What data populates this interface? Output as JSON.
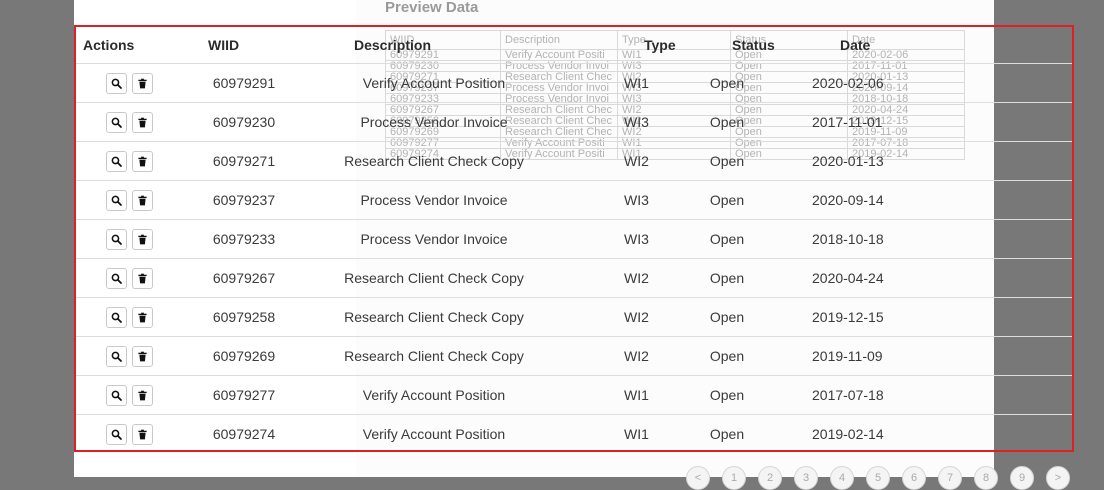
{
  "preview": {
    "title": "Preview Data",
    "columns": [
      "WIID",
      "Description",
      "Type",
      "Status",
      "Date"
    ],
    "rows": [
      [
        "60979291",
        "Verify Account Positi",
        "WI1",
        "Open",
        "2020-02-06"
      ],
      [
        "60979230",
        "Process Vendor Invoi",
        "WI3",
        "Open",
        "2017-11-01"
      ],
      [
        "60979271",
        "Research Client Chec",
        "WI2",
        "Open",
        "2020-01-13"
      ],
      [
        "60979237",
        "Process Vendor Invoi",
        "WI3",
        "Open",
        "2020-09-14"
      ],
      [
        "60979233",
        "Process Vendor Invoi",
        "WI3",
        "Open",
        "2018-10-18"
      ],
      [
        "60979267",
        "Research Client Chec",
        "WI2",
        "Open",
        "2020-04-24"
      ],
      [
        "60979258",
        "Research Client Chec",
        "WI2",
        "Open",
        "2019-12-15"
      ],
      [
        "60979269",
        "Research Client Chec",
        "WI2",
        "Open",
        "2019-11-09"
      ],
      [
        "60979277",
        "Verify Account Positi",
        "WI1",
        "Open",
        "2017-07-18"
      ],
      [
        "60979274",
        "Verify Account Positi",
        "WI1",
        "Open",
        "2019-02-14"
      ]
    ],
    "pager": [
      "<",
      "1",
      "2",
      "3",
      "4",
      "5",
      "6",
      "7",
      "8",
      "9",
      ">"
    ]
  },
  "table": {
    "headers": {
      "actions": "Actions",
      "wiid": "WIID",
      "description": "Description",
      "type": "Type",
      "status": "Status",
      "date": "Date"
    },
    "rows": [
      {
        "wiid": "60979291",
        "description": "Verify Account Position",
        "type": "WI1",
        "status": "Open",
        "date": "2020-02-06"
      },
      {
        "wiid": "60979230",
        "description": "Process Vendor Invoice",
        "type": "WI3",
        "status": "Open",
        "date": "2017-11-01"
      },
      {
        "wiid": "60979271",
        "description": "Research Client Check Copy",
        "type": "WI2",
        "status": "Open",
        "date": "2020-01-13"
      },
      {
        "wiid": "60979237",
        "description": "Process Vendor Invoice",
        "type": "WI3",
        "status": "Open",
        "date": "2020-09-14"
      },
      {
        "wiid": "60979233",
        "description": "Process Vendor Invoice",
        "type": "WI3",
        "status": "Open",
        "date": "2018-10-18"
      },
      {
        "wiid": "60979267",
        "description": "Research Client Check Copy",
        "type": "WI2",
        "status": "Open",
        "date": "2020-04-24"
      },
      {
        "wiid": "60979258",
        "description": "Research Client Check Copy",
        "type": "WI2",
        "status": "Open",
        "date": "2019-12-15"
      },
      {
        "wiid": "60979269",
        "description": "Research Client Check Copy",
        "type": "WI2",
        "status": "Open",
        "date": "2019-11-09"
      },
      {
        "wiid": "60979277",
        "description": "Verify Account Position",
        "type": "WI1",
        "status": "Open",
        "date": "2017-07-18"
      },
      {
        "wiid": "60979274",
        "description": "Verify Account Position",
        "type": "WI1",
        "status": "Open",
        "date": "2019-02-14"
      }
    ]
  },
  "icons": {
    "view": "search-icon",
    "delete": "trash-icon"
  },
  "colors": {
    "highlight_border": "#dd1f26"
  }
}
